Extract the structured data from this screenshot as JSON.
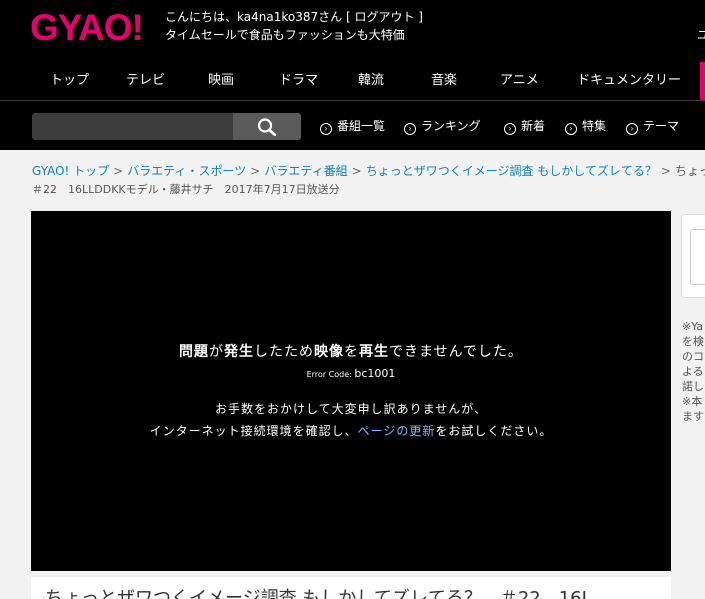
{
  "header": {
    "logo": "GYAO!",
    "greeting_prefix": "こんにちは、",
    "username": "ka4na1ko387",
    "greeting_suffix": "さん",
    "logout_open": " [ ",
    "logout_label": "ログアウト",
    "logout_close": " ]",
    "promo": "タイムセールで食品もファッションも大特価",
    "edge_char": "ユ"
  },
  "global_nav": [
    "トップ",
    "テレビ",
    "映画",
    "ドラマ",
    "韓流",
    "音楽",
    "アニメ",
    "ドキュメンタリー"
  ],
  "search": {
    "value": "",
    "placeholder": "",
    "button_icon": "search-icon"
  },
  "sub_nav": [
    "番組一覧",
    "ランキング",
    "新着",
    "特集",
    "テーマ"
  ],
  "breadcrumb": {
    "items": [
      "GYAO! トップ",
      "バラエティ・スポーツ",
      "バラエティ番組",
      "ちょっとザワつくイメージ調査 もしかしてズレてる？",
      "ちょっ"
    ],
    "separator": ">"
  },
  "episode": {
    "meta": "＃22　16LLDDKKモデル・藤井サチ　2017年7月17日放送分",
    "title_partial": "ちょっとザワつくイメージ調査 もしかしてズレてる？　＃22　16L"
  },
  "player": {
    "error_title_parts": [
      "問題",
      "が",
      "発生",
      "したため",
      "映像",
      "を",
      "再生",
      "できませんでした。"
    ],
    "error_code_label": "Error Code: ",
    "error_code": "bc1001",
    "message_line1": "お手数をおかけして大変申し訳ありませんが、",
    "message_line2_prefix": "インターネット接続環境を確認し、",
    "message_link": "ページの更新",
    "message_line2_suffix": "をお試しください。"
  },
  "side_notes": [
    "※Ya",
    "を検",
    "のコ",
    "よる",
    "諾し",
    "※本",
    "ます"
  ],
  "colors": {
    "brand": "#e6006f",
    "link": "#0a84c8",
    "header_bg": "#000000",
    "player_bg": "#000000",
    "page_bg": "#f2f2f2"
  }
}
